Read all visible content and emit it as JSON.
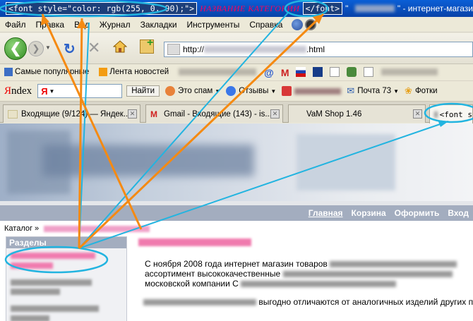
{
  "title_bar": {
    "code_open": "<font style=\"color: rgb(255, 0, 90);\">",
    "category_name": "НАЗВАНИЕ КАТЕГОРИИ",
    "code_close": "</font>",
    "quote": "\"",
    "title_suffix": "\" - интернет-магази"
  },
  "menu": {
    "items": [
      "Файл",
      "Правка",
      "Вид",
      "Журнал",
      "Закладки",
      "Инструменты",
      "Справка"
    ]
  },
  "nav": {
    "back_icon": "back-arrow-icon",
    "forward_icon": "forward-arrow-icon",
    "url_prefix": "http://",
    "url_suffix": ".html"
  },
  "bookmarks": {
    "items": [
      "Самые популярные",
      "Лента новостей"
    ]
  },
  "yandex_bar": {
    "logo_ya": "Я",
    "logo_rest": "ndex",
    "search_glyph": "Я",
    "find": "Найти",
    "spam": "Это спам",
    "reviews": "Отзывы",
    "mail": "Почта 73",
    "photos": "Фотки"
  },
  "tabs": [
    {
      "label": "Входящие (9/124) — Яндек..."
    },
    {
      "label": "Gmail - Входящие (143) - is..."
    },
    {
      "label": "VaM Shop 1.46"
    },
    {
      "label": "<font s"
    }
  ],
  "site": {
    "menu_links": [
      "Главная",
      "Корзина",
      "Оформить",
      "Вход"
    ],
    "breadcrumb": "Каталог »",
    "sidebar_title": "Разделы",
    "para1_line1": "С ноября 2008 года интернет магазин товаров",
    "para1_line2": "ассортимент высококачественные",
    "para1_line3": "московской компании С",
    "para2_line1": "выгодно отличаются от аналогичных изделий других п"
  },
  "annotation_colors": {
    "orange": "#f58a12",
    "cyan": "#22b4e0",
    "pink": "#ff005a"
  }
}
